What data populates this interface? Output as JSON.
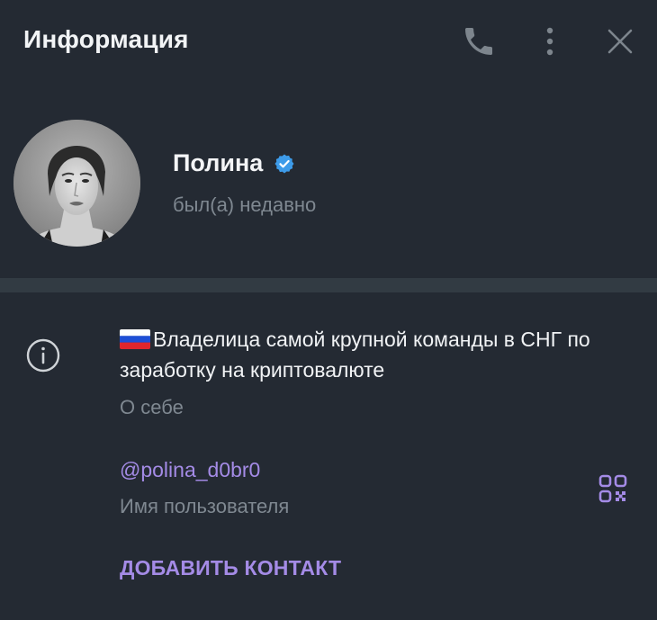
{
  "header": {
    "title": "Информация",
    "icons": [
      "phone-icon",
      "more-vertical-icon",
      "close-icon"
    ]
  },
  "profile": {
    "name": "Полина",
    "status": "был(а) недавно",
    "verified": true
  },
  "bio": {
    "flag": "🇷🇺",
    "text": "Владелица самой крупной команды в СНГ по заработку на криптовалюте",
    "caption": "О себе"
  },
  "username": {
    "value": "@polina_d0br0",
    "caption": "Имя пользователя"
  },
  "actions": {
    "add_contact": "ДОБАВИТЬ КОНТАКТ"
  },
  "colors": {
    "background": "#242a33",
    "divider": "#323b43",
    "accent": "#a48be6",
    "muted": "#7f8891",
    "verified": "#3d9be9"
  }
}
